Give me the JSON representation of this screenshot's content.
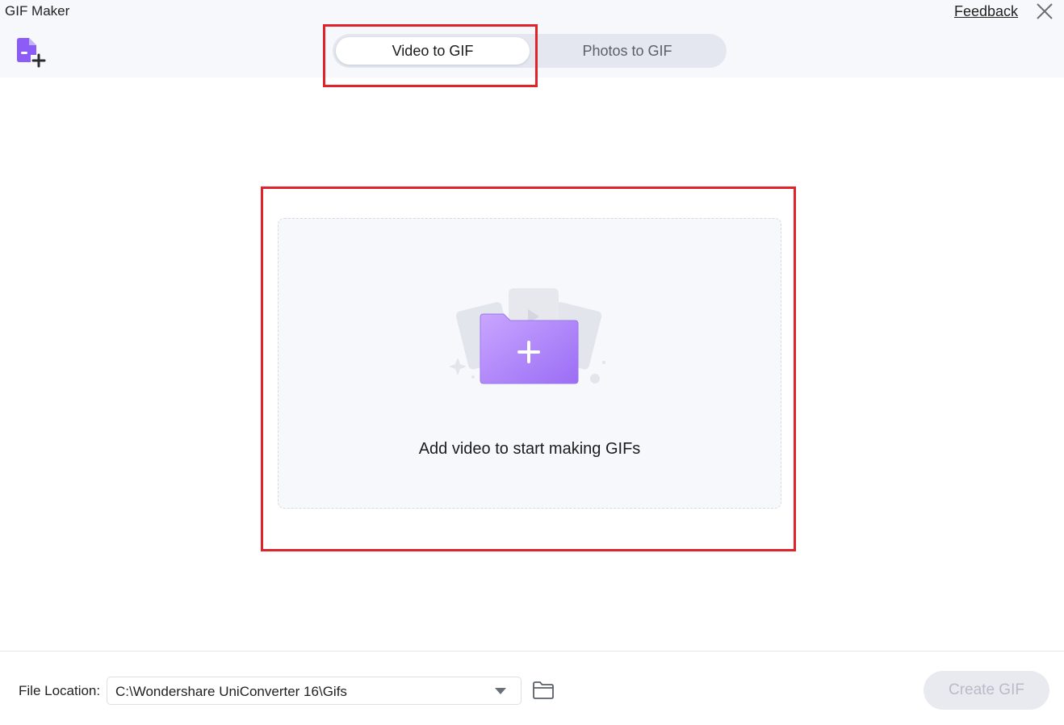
{
  "window": {
    "title": "GIF Maker",
    "feedback_label": "Feedback"
  },
  "tabs": [
    {
      "label": "Video to GIF",
      "active": true
    },
    {
      "label": "Photos to GIF",
      "active": false
    }
  ],
  "dropzone": {
    "text": "Add video to start making GIFs",
    "icon": "folder-plus-icon"
  },
  "footer": {
    "file_location_label": "File Location:",
    "file_location_value": "C:\\Wondershare UniConverter 16\\Gifs",
    "create_label": "Create GIF",
    "create_enabled": false
  },
  "colors": {
    "accent": "#8b5cf6",
    "highlight": "#e0222a",
    "header_bg": "#f7f8fb"
  }
}
